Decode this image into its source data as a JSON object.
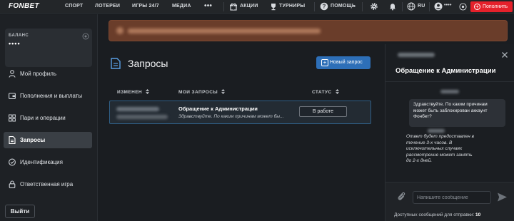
{
  "colors": {
    "accent_red": "#e5212b",
    "accent_blue": "#2d6fb8",
    "banner": "#6a3d2a",
    "row_border": "#2f5f86"
  },
  "header": {
    "logo": "FONBET",
    "nav": [
      {
        "label": "СПОРТ"
      },
      {
        "label": "ЛОТЕРЕИ"
      },
      {
        "label": "ИГРЫ 24/7"
      },
      {
        "label": "МЕДИА"
      },
      {
        "label": "•••"
      }
    ],
    "promos_label": "АКЦИИ",
    "tournaments_label": "ТУРНИРЫ",
    "help_label": "ПОМОЩЬ",
    "language": "RU",
    "account_masked": "••••",
    "topup_label": "Пополнить",
    "icons": [
      "gift-icon",
      "trophy-icon",
      "help-icon",
      "gear-icon",
      "bell-icon",
      "globe-icon",
      "user-icon",
      "eye-icon"
    ]
  },
  "sidebar": {
    "balance_label": "БАЛАНС",
    "balance_value": "••••",
    "items": [
      {
        "label": "Мой профиль",
        "icon": "user-icon"
      },
      {
        "label": "Пополнения и выплаты",
        "icon": "wallet-icon"
      },
      {
        "label": "Пари и операции",
        "icon": "grid-icon"
      },
      {
        "label": "Запросы",
        "icon": "document-icon",
        "active": true
      },
      {
        "label": "Идентификация",
        "icon": "shield-icon"
      },
      {
        "label": "Ответственная игра",
        "icon": "lock-icon"
      }
    ],
    "logout_label": "Выйти"
  },
  "requests": {
    "title": "Запросы",
    "new_button_label": "Новый запрос",
    "columns": {
      "changed": "ИЗМЕНЕН",
      "my_requests": "МОИ ЗАПРОСЫ",
      "status": "СТАТУС"
    },
    "rows": [
      {
        "subject": "Обращение к Администрации",
        "preview": "Здравствуйте. По каким причинам может бы...",
        "status": "В работе"
      }
    ]
  },
  "chat": {
    "title": "Обращение к Администрации",
    "messages": {
      "user": "Здравствуйте. По каким причинам может быть заблокирован аккаунт Фонбет?",
      "support": "Ответ будет предоставлен в течение 3-х часов. В исключительных случаях рассмотрение может занять до 2-х дней."
    },
    "input_placeholder": "Напишите сообщение",
    "counter_label": "Доступных сообщений для отправки:",
    "counter_value": "10"
  }
}
